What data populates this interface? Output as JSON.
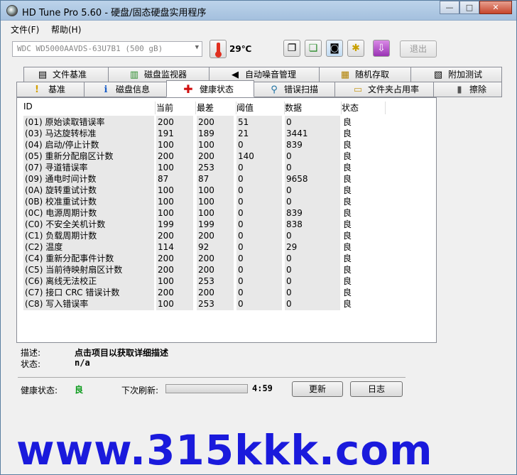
{
  "window": {
    "title": "HD Tune Pro 5.60 - 硬盘/固态硬盘实用程序",
    "min": "—",
    "max": "□",
    "close": "✕"
  },
  "menu": [
    {
      "label": "文件(F)"
    },
    {
      "label": "帮助(H)"
    }
  ],
  "toolbar": {
    "drive": "WDC WD5000AAVDS-63U7B1 (500 gB)",
    "temperature": "29℃",
    "exit": "退出",
    "icons": [
      "copy-text-icon",
      "copy-screenshot-icon",
      "camera-icon",
      "options-icon",
      "save-icon"
    ]
  },
  "tabs_row1": [
    {
      "label": "文件基准",
      "icon": "file-benchmark-icon",
      "glyph": "▤"
    },
    {
      "label": "磁盘监视器",
      "icon": "disk-monitor-icon",
      "glyph": "▥"
    },
    {
      "label": "自动噪音管理",
      "icon": "speaker-icon",
      "glyph": "◀"
    },
    {
      "label": "随机存取",
      "icon": "random-access-icon",
      "glyph": "▦"
    },
    {
      "label": "附加测试",
      "icon": "extra-tests-icon",
      "glyph": "▧"
    }
  ],
  "tabs_row2": [
    {
      "label": "基准",
      "icon": "benchmark-icon",
      "glyph": "!"
    },
    {
      "label": "磁盘信息",
      "icon": "info-icon",
      "glyph": "i"
    },
    {
      "label": "健康状态",
      "icon": "health-cross-icon",
      "glyph": "✚"
    },
    {
      "label": "错误扫描",
      "icon": "magnifier-icon",
      "glyph": "⚲"
    },
    {
      "label": "文件夹占用率",
      "icon": "folder-icon",
      "glyph": "▭"
    },
    {
      "label": "擦除",
      "icon": "trash-icon",
      "glyph": "▮"
    }
  ],
  "smart": {
    "headers": [
      "ID",
      "当前",
      "最差",
      "阈值",
      "数据",
      "状态"
    ],
    "rows": [
      {
        "id": "(01) 原始读取错误率",
        "current": "200",
        "worst": "200",
        "threshold": "51",
        "data": "0",
        "status": "良"
      },
      {
        "id": "(03) 马达旋转标准",
        "current": "191",
        "worst": "189",
        "threshold": "21",
        "data": "3441",
        "status": "良"
      },
      {
        "id": "(04) 启动/停止计数",
        "current": "100",
        "worst": "100",
        "threshold": "0",
        "data": "839",
        "status": "良"
      },
      {
        "id": "(05) 重新分配扇区计数",
        "current": "200",
        "worst": "200",
        "threshold": "140",
        "data": "0",
        "status": "良"
      },
      {
        "id": "(07) 寻道错误率",
        "current": "100",
        "worst": "253",
        "threshold": "0",
        "data": "0",
        "status": "良"
      },
      {
        "id": "(09) 通电时间计数",
        "current": "87",
        "worst": "87",
        "threshold": "0",
        "data": "9658",
        "status": "良"
      },
      {
        "id": "(0A) 旋转重试计数",
        "current": "100",
        "worst": "100",
        "threshold": "0",
        "data": "0",
        "status": "良"
      },
      {
        "id": "(0B) 校准重试计数",
        "current": "100",
        "worst": "100",
        "threshold": "0",
        "data": "0",
        "status": "良"
      },
      {
        "id": "(0C) 电源周期计数",
        "current": "100",
        "worst": "100",
        "threshold": "0",
        "data": "839",
        "status": "良"
      },
      {
        "id": "(C0) 不安全关机计数",
        "current": "199",
        "worst": "199",
        "threshold": "0",
        "data": "838",
        "status": "良"
      },
      {
        "id": "(C1) 负载周期计数",
        "current": "200",
        "worst": "200",
        "threshold": "0",
        "data": "0",
        "status": "良"
      },
      {
        "id": "(C2) 温度",
        "current": "114",
        "worst": "92",
        "threshold": "0",
        "data": "29",
        "status": "良"
      },
      {
        "id": "(C4) 重新分配事件计数",
        "current": "200",
        "worst": "200",
        "threshold": "0",
        "data": "0",
        "status": "良"
      },
      {
        "id": "(C5) 当前待映射扇区计数",
        "current": "200",
        "worst": "200",
        "threshold": "0",
        "data": "0",
        "status": "良"
      },
      {
        "id": "(C6) 离线无法校正",
        "current": "100",
        "worst": "253",
        "threshold": "0",
        "data": "0",
        "status": "良"
      },
      {
        "id": "(C7) 接口 CRC 错误计数",
        "current": "200",
        "worst": "200",
        "threshold": "0",
        "data": "0",
        "status": "良"
      },
      {
        "id": "(C8) 写入错误率",
        "current": "100",
        "worst": "253",
        "threshold": "0",
        "data": "0",
        "status": "良"
      }
    ]
  },
  "details": {
    "desc_label": "描述:",
    "desc_value": "点击项目以获取详细描述",
    "status_label": "状态:",
    "status_value": "n/a"
  },
  "footer": {
    "health_label": "健康状态:",
    "health_value": "良",
    "next_refresh_label": "下次刷新:",
    "next_refresh_value": "4:59",
    "refresh_button": "更新",
    "log_button": "日志",
    "health_color": "#0a9a1a"
  },
  "watermark": "www.315kkk.com"
}
